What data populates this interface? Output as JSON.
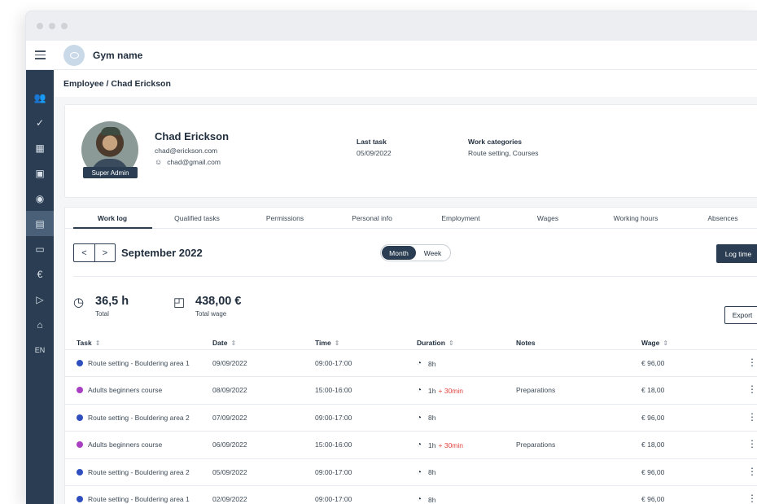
{
  "app": {
    "gym_name": "Gym name"
  },
  "sidebar": {
    "items": [
      {
        "icon": "people-icon",
        "glyph": "👥"
      },
      {
        "icon": "check-circle-icon",
        "glyph": "✓"
      },
      {
        "icon": "building-icon",
        "glyph": "▦"
      },
      {
        "icon": "calendar-icon",
        "glyph": "▣"
      },
      {
        "icon": "eye-icon",
        "glyph": "◉"
      },
      {
        "icon": "id-card-icon",
        "glyph": "▤",
        "active": true
      },
      {
        "icon": "wallet-icon",
        "glyph": "▭"
      },
      {
        "icon": "euro-icon",
        "glyph": "€"
      },
      {
        "icon": "play-icon",
        "glyph": "▷"
      },
      {
        "icon": "home-icon",
        "glyph": "⌂"
      }
    ],
    "language": "EN"
  },
  "breadcrumb": "Employee / Chad Erickson",
  "profile": {
    "name": "Chad Erickson",
    "email_work": "chad@erickson.com",
    "email_personal": "chad@gmail.com",
    "role_badge": "Super Admin",
    "last_task_label": "Last task",
    "last_task_value": "05/09/2022",
    "work_categories_label": "Work categories",
    "work_categories_value": "Route setting, Courses"
  },
  "tabs": [
    "Work log",
    "Qualified tasks",
    "Permissions",
    "Personal info",
    "Employment",
    "Wages",
    "Working hours",
    "Absences"
  ],
  "active_tab": "Work log",
  "period": {
    "prev": "<",
    "next": ">",
    "label": "September 2022",
    "toggle": [
      "Month",
      "Week"
    ],
    "selected": "Month"
  },
  "log_time_label": "Log time",
  "stats": {
    "total_hours": "36,5 h",
    "total_hours_label": "Total",
    "total_wage": "438,00 €",
    "total_wage_label": "Total wage"
  },
  "export_label": "Export",
  "table": {
    "columns": [
      {
        "label": "Task",
        "sortable": true
      },
      {
        "label": "Date",
        "sortable": true
      },
      {
        "label": "Time",
        "sortable": true
      },
      {
        "label": "Duration",
        "sortable": true
      },
      {
        "label": "Notes",
        "sortable": false
      },
      {
        "label": "Wage",
        "sortable": true
      }
    ],
    "rows": [
      {
        "task": "Route setting - Bouldering area 1",
        "color": "#2f4fbf",
        "date": "09/09/2022",
        "time": "09:00-17:00",
        "duration": "8h",
        "extra": "",
        "notes": "",
        "wage": "€ 96,00"
      },
      {
        "task": "Adults beginners course",
        "color": "#a93fc2",
        "date": "08/09/2022",
        "time": "15:00-16:00",
        "duration": "1h",
        "extra": "+ 30min",
        "notes": "Preparations",
        "wage": "€ 18,00"
      },
      {
        "task": "Route setting - Bouldering area 2",
        "color": "#2f4fbf",
        "date": "07/09/2022",
        "time": "09:00-17:00",
        "duration": "8h",
        "extra": "",
        "notes": "",
        "wage": "€ 96,00"
      },
      {
        "task": "Adults beginners course",
        "color": "#a93fc2",
        "date": "06/09/2022",
        "time": "15:00-16:00",
        "duration": "1h",
        "extra": "+ 30min",
        "notes": "Preparations",
        "wage": "€ 18,00"
      },
      {
        "task": "Route setting - Bouldering area 2",
        "color": "#2f4fbf",
        "date": "05/09/2022",
        "time": "09:00-17:00",
        "duration": "8h",
        "extra": "",
        "notes": "",
        "wage": "€ 96,00"
      },
      {
        "task": "Route setting - Bouldering area 1",
        "color": "#2f4fbf",
        "date": "02/09/2022",
        "time": "09:00-17:00",
        "duration": "8h",
        "extra": "",
        "notes": "",
        "wage": "€ 96,00"
      }
    ]
  }
}
